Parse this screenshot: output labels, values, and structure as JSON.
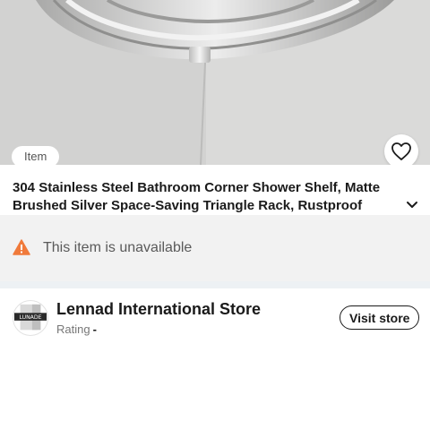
{
  "hero": {
    "tag": "Item",
    "favorite_icon": "heart-outline-icon"
  },
  "product": {
    "title": "304 Stainless Steel Bathroom Corner Shower Shelf, Matte Brushed Silver Space-Saving Triangle Rack, Rustproof Modern",
    "expand_icon": "chevron-down-icon"
  },
  "notice": {
    "icon": "warning-icon",
    "text": "This item is unavailable",
    "icon_color": "#f07a3b"
  },
  "store": {
    "name": "Lennad International Store",
    "logo_text": "LUNADE",
    "rating_label": "Rating",
    "rating_value": "-",
    "visit_label": "Visit store"
  }
}
